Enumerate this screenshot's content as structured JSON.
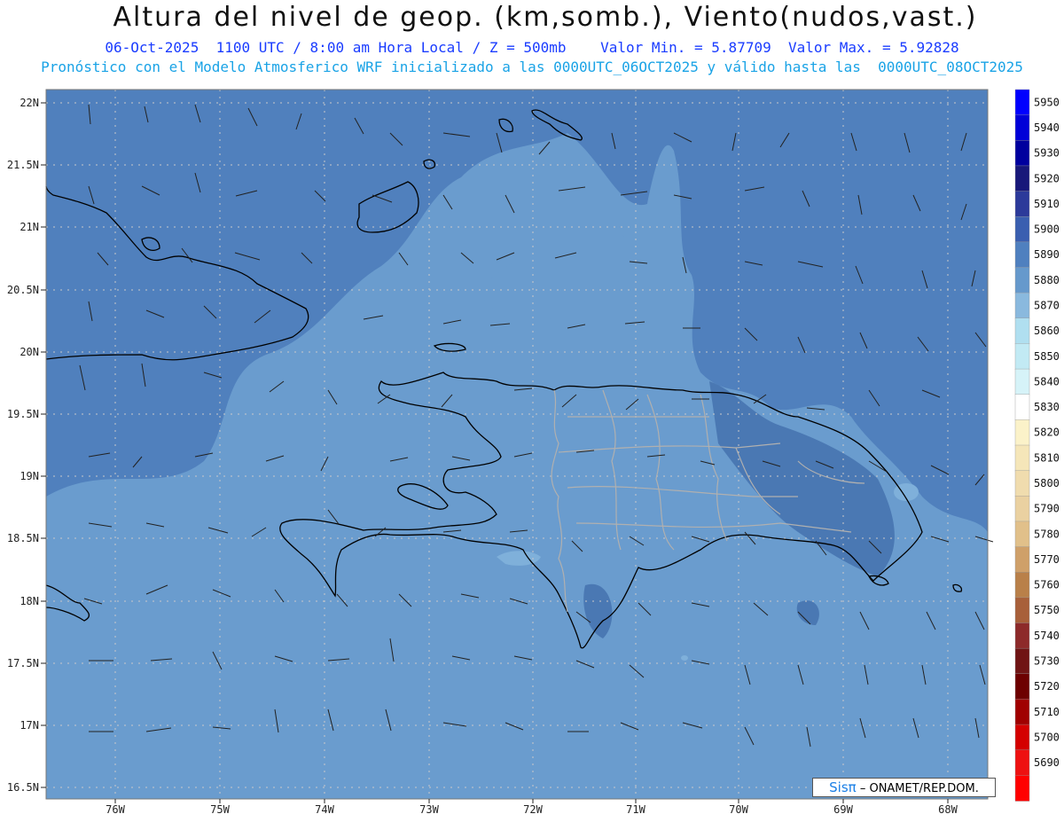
{
  "title": "Altura del nivel de geop. (km,somb.), Viento(nudos,vast.)",
  "subtitle_line1": "06-Oct-2025  1100 UTC / 8:00 am Hora Local / Z = 500mb    Valor Min. = 5.87709  Valor Max. = 5.92828",
  "subtitle_line2": "Pronóstico con el Modelo Atmosferico WRF inicializado a las 0000UTC_06OCT2025 y válido hasta las  0000UTC_08OCT2025",
  "credit": {
    "brand": "Sisπ",
    "text": "– ONAMET/REP.DOM."
  },
  "map": {
    "lat_labels": [
      "22N",
      "21.5N",
      "21N",
      "20.5N",
      "20N",
      "19.5N",
      "19N",
      "18.5N",
      "18N",
      "17.5N",
      "17N",
      "16.5N"
    ],
    "lon_labels": [
      "76W",
      "75W",
      "74W",
      "73W",
      "72W",
      "71W",
      "70W",
      "69W",
      "68W"
    ],
    "lon_range": [
      -76.7,
      -67.6
    ],
    "lat_range": [
      16.4,
      22.1
    ],
    "colors": {
      "dark_field": "#5080bd",
      "light_field": "#6a9cce",
      "pale_field": "#7fb0da",
      "coast": "#000000",
      "province_border": "#b0b0b0",
      "grid": "#c9c9c9"
    }
  },
  "colorbar": {
    "levels": [
      "5950",
      "5940",
      "5930",
      "5920",
      "5910",
      "5900",
      "5890",
      "5880",
      "5870",
      "5860",
      "5850",
      "5840",
      "5830",
      "5820",
      "5810",
      "5800",
      "5790",
      "5780",
      "5770",
      "5760",
      "5750",
      "5740",
      "5730",
      "5720",
      "5710",
      "5700",
      "5690"
    ],
    "colors": [
      "#0000ff",
      "#0000d8",
      "#00009e",
      "#18187a",
      "#2c3a9a",
      "#3a5fb0",
      "#4f80bf",
      "#6699cc",
      "#8ab9de",
      "#b0dff0",
      "#c2eaf4",
      "#d6f3f8",
      "#ffffff",
      "#fbf2c9",
      "#f5e6b9",
      "#f0dcae",
      "#ead1a1",
      "#e1c08a",
      "#cfa069",
      "#b98049",
      "#a8603a",
      "#8d2a2a",
      "#701414",
      "#6d0000",
      "#a00000",
      "#d40000",
      "#ee1111",
      "#ff0000"
    ]
  }
}
